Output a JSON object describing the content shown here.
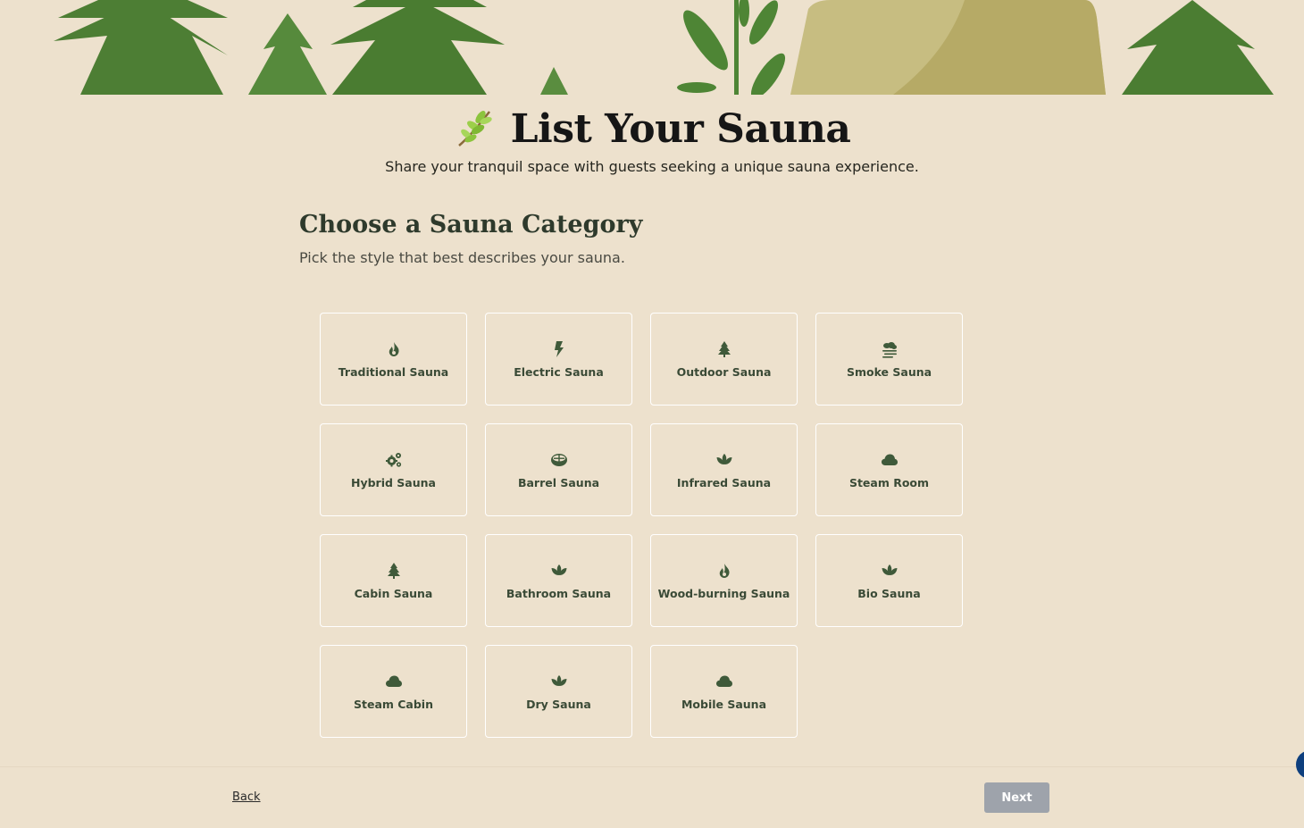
{
  "header": {
    "title": "List Your Sauna",
    "title_icon": "herb-icon",
    "subtitle": "Share your tranquil space with guests seeking a unique sauna experience."
  },
  "section": {
    "title": "Choose a Sauna Category",
    "subtitle": "Pick the style that best describes your sauna."
  },
  "categories": [
    {
      "label": "Traditional Sauna",
      "icon": "fire-icon"
    },
    {
      "label": "Electric Sauna",
      "icon": "bolt-icon"
    },
    {
      "label": "Outdoor Sauna",
      "icon": "tree-icon"
    },
    {
      "label": "Smoke Sauna",
      "icon": "smog-icon"
    },
    {
      "label": "Hybrid Sauna",
      "icon": "gears-icon"
    },
    {
      "label": "Barrel Sauna",
      "icon": "barrel-icon"
    },
    {
      "label": "Infrared Sauna",
      "icon": "spa-leaf-icon"
    },
    {
      "label": "Steam Room",
      "icon": "cloud-icon"
    },
    {
      "label": "Cabin Sauna",
      "icon": "tree-icon"
    },
    {
      "label": "Bathroom Sauna",
      "icon": "spa-leaf-icon"
    },
    {
      "label": "Wood-burning Sauna",
      "icon": "fire-icon"
    },
    {
      "label": "Bio Sauna",
      "icon": "spa-leaf-icon"
    },
    {
      "label": "Steam Cabin",
      "icon": "cloud-icon"
    },
    {
      "label": "Dry Sauna",
      "icon": "spa-leaf-icon"
    },
    {
      "label": "Mobile Sauna",
      "icon": "cloud-icon"
    }
  ],
  "footer": {
    "back_label": "Back",
    "next_label": "Next"
  },
  "colors": {
    "background": "#ede1cd",
    "icon": "#3f5a3a",
    "tree": "#4f8136",
    "next_disabled": "#9ea3ab",
    "help_bubble": "#0e3f7e"
  }
}
